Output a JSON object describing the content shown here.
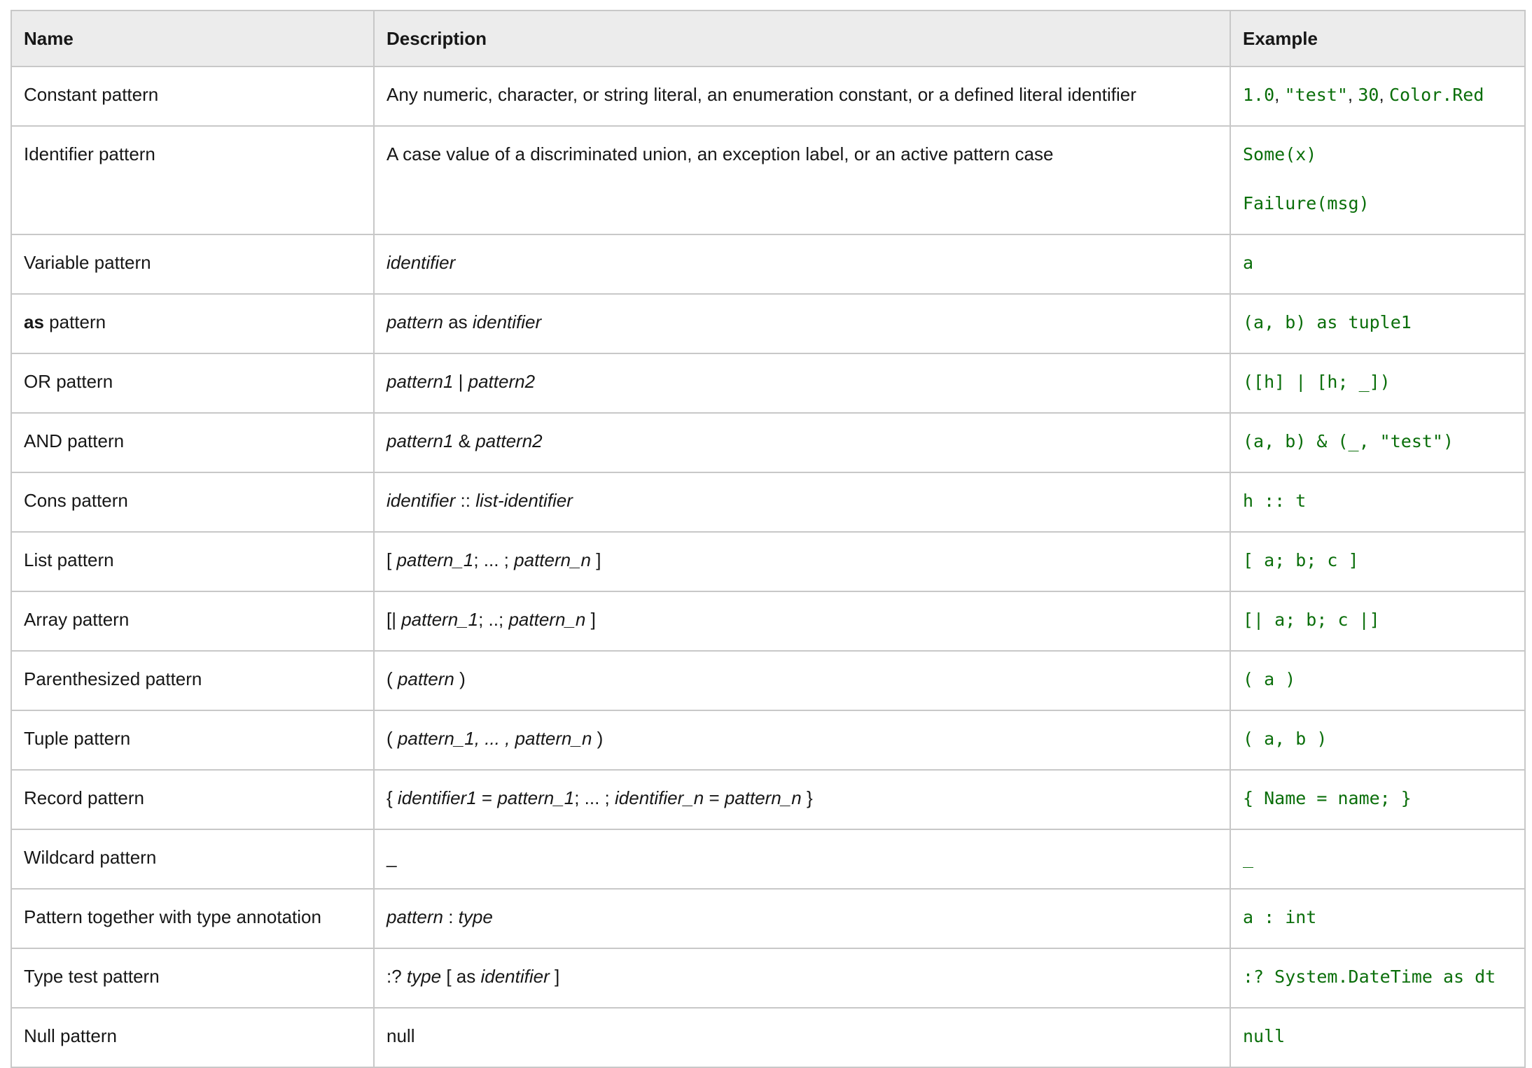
{
  "headers": {
    "name": "Name",
    "description": "Description",
    "example": "Example"
  },
  "rows": [
    {
      "name": "Constant pattern",
      "description": "Any numeric, character, or string literal, an enumeration constant, or a defined literal identifier",
      "example": [
        "1.0",
        "\"test\"",
        "30",
        "Color.Red"
      ]
    },
    {
      "name": "Identifier pattern",
      "description": "A case value of a discriminated union, an exception label, or an active pattern case",
      "example": [
        "Some(x)",
        "Failure(msg)"
      ]
    },
    {
      "name": "Variable pattern",
      "description": "identifier",
      "example": "a"
    },
    {
      "name_bold": "as",
      "name": "pattern",
      "description_parts": [
        "pattern",
        "as",
        "identifier"
      ],
      "example": "(a, b) as tuple1"
    },
    {
      "name": "OR pattern",
      "description_parts": [
        "pattern1",
        "|",
        "pattern2"
      ],
      "example": "([h] | [h; _])"
    },
    {
      "name": "AND pattern",
      "description_parts": [
        "pattern1",
        "&",
        "pattern2"
      ],
      "example": "(a, b) & (_, \"test\")"
    },
    {
      "name": "Cons pattern",
      "description_parts": [
        "identifier",
        "::",
        "list-identifier"
      ],
      "example": "h :: t"
    },
    {
      "name": "List pattern",
      "description_parts": [
        "[",
        "pattern_1",
        "; ... ;",
        "pattern_n",
        "]"
      ],
      "example": "[ a; b; c ]"
    },
    {
      "name": "Array pattern",
      "description_parts": [
        "[|",
        "pattern_1",
        "; ..;",
        "pattern_n",
        "]"
      ],
      "example": "[| a; b; c |]"
    },
    {
      "name": "Parenthesized pattern",
      "description_parts": [
        "(",
        "pattern",
        ")"
      ],
      "example": "( a )"
    },
    {
      "name": "Tuple pattern",
      "description_parts": [
        "(",
        "pattern_1, ... , pattern_n",
        ")"
      ],
      "example": "( a, b )"
    },
    {
      "name": "Record pattern",
      "description_parts": [
        "{",
        "identifier1",
        "=",
        "pattern_1",
        "; ... ;",
        "identifier_n",
        "=",
        "pattern_n",
        "}"
      ],
      "example": "{ Name = name; }"
    },
    {
      "name": "Wildcard pattern",
      "description": "_",
      "example": "_"
    },
    {
      "name": "Pattern together with type annotation",
      "description_parts": [
        "pattern",
        ":",
        "type"
      ],
      "example": "a : int"
    },
    {
      "name": "Type test pattern",
      "description_parts": [
        ":?",
        "type",
        "[ as",
        "identifier",
        "]"
      ],
      "example": ":? System.DateTime as dt"
    },
    {
      "name": "Null pattern",
      "description": "null",
      "example": "null"
    }
  ]
}
